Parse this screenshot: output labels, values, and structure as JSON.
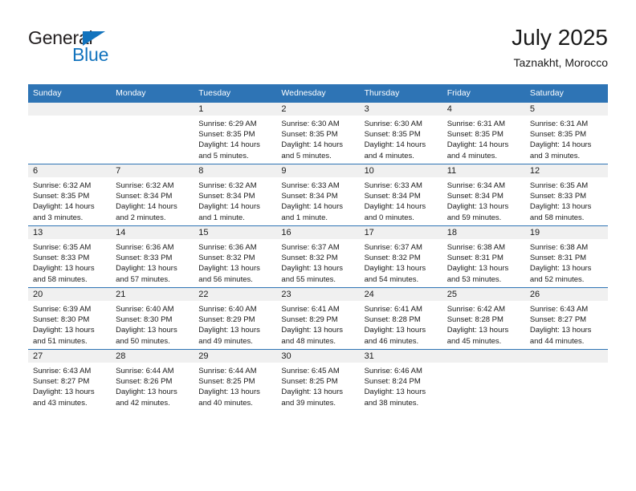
{
  "logo": {
    "word_top": "General",
    "word_bottom": "Blue",
    "triangle_color": "#1273bd",
    "text_color": "#231f20"
  },
  "header": {
    "title": "July 2025",
    "subtitle": "Taznakht, Morocco"
  },
  "theme": {
    "header_blue": "#2e74b5",
    "daynum_band": "#f0f0f0",
    "text": "#1a1a1a"
  },
  "weekday_headers": [
    "Sunday",
    "Monday",
    "Tuesday",
    "Wednesday",
    "Thursday",
    "Friday",
    "Saturday"
  ],
  "weeks": [
    [
      {
        "day": "",
        "empty": true,
        "sunrise": "",
        "sunset": "",
        "daylight1": "",
        "daylight2": ""
      },
      {
        "day": "",
        "empty": true,
        "sunrise": "",
        "sunset": "",
        "daylight1": "",
        "daylight2": ""
      },
      {
        "day": "1",
        "empty": false,
        "sunrise": "Sunrise: 6:29 AM",
        "sunset": "Sunset: 8:35 PM",
        "daylight1": "Daylight: 14 hours",
        "daylight2": "and 5 minutes."
      },
      {
        "day": "2",
        "empty": false,
        "sunrise": "Sunrise: 6:30 AM",
        "sunset": "Sunset: 8:35 PM",
        "daylight1": "Daylight: 14 hours",
        "daylight2": "and 5 minutes."
      },
      {
        "day": "3",
        "empty": false,
        "sunrise": "Sunrise: 6:30 AM",
        "sunset": "Sunset: 8:35 PM",
        "daylight1": "Daylight: 14 hours",
        "daylight2": "and 4 minutes."
      },
      {
        "day": "4",
        "empty": false,
        "sunrise": "Sunrise: 6:31 AM",
        "sunset": "Sunset: 8:35 PM",
        "daylight1": "Daylight: 14 hours",
        "daylight2": "and 4 minutes."
      },
      {
        "day": "5",
        "empty": false,
        "sunrise": "Sunrise: 6:31 AM",
        "sunset": "Sunset: 8:35 PM",
        "daylight1": "Daylight: 14 hours",
        "daylight2": "and 3 minutes."
      }
    ],
    [
      {
        "day": "6",
        "empty": false,
        "sunrise": "Sunrise: 6:32 AM",
        "sunset": "Sunset: 8:35 PM",
        "daylight1": "Daylight: 14 hours",
        "daylight2": "and 3 minutes."
      },
      {
        "day": "7",
        "empty": false,
        "sunrise": "Sunrise: 6:32 AM",
        "sunset": "Sunset: 8:34 PM",
        "daylight1": "Daylight: 14 hours",
        "daylight2": "and 2 minutes."
      },
      {
        "day": "8",
        "empty": false,
        "sunrise": "Sunrise: 6:32 AM",
        "sunset": "Sunset: 8:34 PM",
        "daylight1": "Daylight: 14 hours",
        "daylight2": "and 1 minute."
      },
      {
        "day": "9",
        "empty": false,
        "sunrise": "Sunrise: 6:33 AM",
        "sunset": "Sunset: 8:34 PM",
        "daylight1": "Daylight: 14 hours",
        "daylight2": "and 1 minute."
      },
      {
        "day": "10",
        "empty": false,
        "sunrise": "Sunrise: 6:33 AM",
        "sunset": "Sunset: 8:34 PM",
        "daylight1": "Daylight: 14 hours",
        "daylight2": "and 0 minutes."
      },
      {
        "day": "11",
        "empty": false,
        "sunrise": "Sunrise: 6:34 AM",
        "sunset": "Sunset: 8:34 PM",
        "daylight1": "Daylight: 13 hours",
        "daylight2": "and 59 minutes."
      },
      {
        "day": "12",
        "empty": false,
        "sunrise": "Sunrise: 6:35 AM",
        "sunset": "Sunset: 8:33 PM",
        "daylight1": "Daylight: 13 hours",
        "daylight2": "and 58 minutes."
      }
    ],
    [
      {
        "day": "13",
        "empty": false,
        "sunrise": "Sunrise: 6:35 AM",
        "sunset": "Sunset: 8:33 PM",
        "daylight1": "Daylight: 13 hours",
        "daylight2": "and 58 minutes."
      },
      {
        "day": "14",
        "empty": false,
        "sunrise": "Sunrise: 6:36 AM",
        "sunset": "Sunset: 8:33 PM",
        "daylight1": "Daylight: 13 hours",
        "daylight2": "and 57 minutes."
      },
      {
        "day": "15",
        "empty": false,
        "sunrise": "Sunrise: 6:36 AM",
        "sunset": "Sunset: 8:32 PM",
        "daylight1": "Daylight: 13 hours",
        "daylight2": "and 56 minutes."
      },
      {
        "day": "16",
        "empty": false,
        "sunrise": "Sunrise: 6:37 AM",
        "sunset": "Sunset: 8:32 PM",
        "daylight1": "Daylight: 13 hours",
        "daylight2": "and 55 minutes."
      },
      {
        "day": "17",
        "empty": false,
        "sunrise": "Sunrise: 6:37 AM",
        "sunset": "Sunset: 8:32 PM",
        "daylight1": "Daylight: 13 hours",
        "daylight2": "and 54 minutes."
      },
      {
        "day": "18",
        "empty": false,
        "sunrise": "Sunrise: 6:38 AM",
        "sunset": "Sunset: 8:31 PM",
        "daylight1": "Daylight: 13 hours",
        "daylight2": "and 53 minutes."
      },
      {
        "day": "19",
        "empty": false,
        "sunrise": "Sunrise: 6:38 AM",
        "sunset": "Sunset: 8:31 PM",
        "daylight1": "Daylight: 13 hours",
        "daylight2": "and 52 minutes."
      }
    ],
    [
      {
        "day": "20",
        "empty": false,
        "sunrise": "Sunrise: 6:39 AM",
        "sunset": "Sunset: 8:30 PM",
        "daylight1": "Daylight: 13 hours",
        "daylight2": "and 51 minutes."
      },
      {
        "day": "21",
        "empty": false,
        "sunrise": "Sunrise: 6:40 AM",
        "sunset": "Sunset: 8:30 PM",
        "daylight1": "Daylight: 13 hours",
        "daylight2": "and 50 minutes."
      },
      {
        "day": "22",
        "empty": false,
        "sunrise": "Sunrise: 6:40 AM",
        "sunset": "Sunset: 8:29 PM",
        "daylight1": "Daylight: 13 hours",
        "daylight2": "and 49 minutes."
      },
      {
        "day": "23",
        "empty": false,
        "sunrise": "Sunrise: 6:41 AM",
        "sunset": "Sunset: 8:29 PM",
        "daylight1": "Daylight: 13 hours",
        "daylight2": "and 48 minutes."
      },
      {
        "day": "24",
        "empty": false,
        "sunrise": "Sunrise: 6:41 AM",
        "sunset": "Sunset: 8:28 PM",
        "daylight1": "Daylight: 13 hours",
        "daylight2": "and 46 minutes."
      },
      {
        "day": "25",
        "empty": false,
        "sunrise": "Sunrise: 6:42 AM",
        "sunset": "Sunset: 8:28 PM",
        "daylight1": "Daylight: 13 hours",
        "daylight2": "and 45 minutes."
      },
      {
        "day": "26",
        "empty": false,
        "sunrise": "Sunrise: 6:43 AM",
        "sunset": "Sunset: 8:27 PM",
        "daylight1": "Daylight: 13 hours",
        "daylight2": "and 44 minutes."
      }
    ],
    [
      {
        "day": "27",
        "empty": false,
        "sunrise": "Sunrise: 6:43 AM",
        "sunset": "Sunset: 8:27 PM",
        "daylight1": "Daylight: 13 hours",
        "daylight2": "and 43 minutes."
      },
      {
        "day": "28",
        "empty": false,
        "sunrise": "Sunrise: 6:44 AM",
        "sunset": "Sunset: 8:26 PM",
        "daylight1": "Daylight: 13 hours",
        "daylight2": "and 42 minutes."
      },
      {
        "day": "29",
        "empty": false,
        "sunrise": "Sunrise: 6:44 AM",
        "sunset": "Sunset: 8:25 PM",
        "daylight1": "Daylight: 13 hours",
        "daylight2": "and 40 minutes."
      },
      {
        "day": "30",
        "empty": false,
        "sunrise": "Sunrise: 6:45 AM",
        "sunset": "Sunset: 8:25 PM",
        "daylight1": "Daylight: 13 hours",
        "daylight2": "and 39 minutes."
      },
      {
        "day": "31",
        "empty": false,
        "sunrise": "Sunrise: 6:46 AM",
        "sunset": "Sunset: 8:24 PM",
        "daylight1": "Daylight: 13 hours",
        "daylight2": "and 38 minutes."
      },
      {
        "day": "",
        "empty": true,
        "sunrise": "",
        "sunset": "",
        "daylight1": "",
        "daylight2": ""
      },
      {
        "day": "",
        "empty": true,
        "sunrise": "",
        "sunset": "",
        "daylight1": "",
        "daylight2": ""
      }
    ]
  ]
}
